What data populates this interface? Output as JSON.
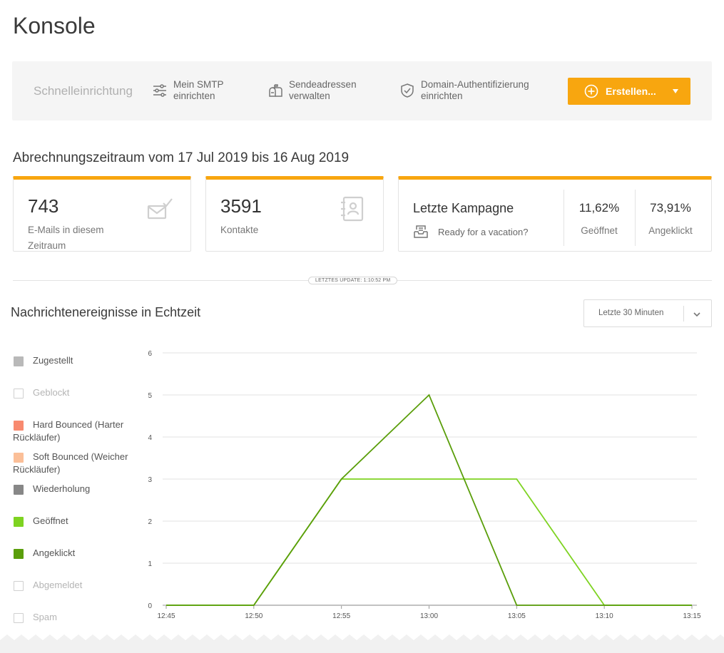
{
  "page": {
    "title": "Konsole"
  },
  "quick_setup": {
    "label": "Schnelleinrichtung",
    "items": [
      {
        "icon": "sliders-icon",
        "line1": "Mein SMTP",
        "line2": "einrichten"
      },
      {
        "icon": "mailbox-icon",
        "line1": "Sendeadressen",
        "line2": "verwalten"
      },
      {
        "icon": "shield-check-icon",
        "line1": "Domain-Authentifizierung",
        "line2": "einrichten"
      }
    ],
    "create_button": {
      "label": "Erstellen...",
      "color": "#f8a60f"
    }
  },
  "billing": {
    "title": "Abrechnungszeitraum vom 17 Jul 2019 bis 16 Aug 2019",
    "emails": {
      "value": "743",
      "label": "E-Mails in diesem Zeitraum",
      "icon": "envelope-check-icon"
    },
    "contacts": {
      "value": "3591",
      "label": "Kontakte",
      "icon": "address-book-icon"
    },
    "campaign": {
      "label": "Letzte Kampagne",
      "name": "Ready for a vacation?",
      "icon": "mail-tray-icon",
      "opened": {
        "value": "11,62%",
        "label": "Geöffnet"
      },
      "clicked": {
        "value": "73,91%",
        "label": "Angeklickt"
      }
    }
  },
  "last_update": "LETZTES UPDATE: 1:10:52 PM",
  "events": {
    "title": "Nachrichtenereignisse in Echtzeit",
    "range": "Letzte 30 Minuten",
    "legend": [
      {
        "label": "Zugestellt",
        "color": "#b9b9b9",
        "active": true
      },
      {
        "label": "Geblockt",
        "color": "#ffffff",
        "active": false
      },
      {
        "label": "Hard Bounced (Harter Rückläufer)",
        "color": "#f88a6f",
        "active": true
      },
      {
        "label": "Soft Bounced (Weicher Rückläufer)",
        "color": "#fbbf98",
        "active": true
      },
      {
        "label": "Wiederholung",
        "color": "#878787",
        "active": true
      },
      {
        "label": "Geöffnet",
        "color": "#7ed321",
        "active": true
      },
      {
        "label": "Angeklickt",
        "color": "#5a9e0a",
        "active": true
      },
      {
        "label": "Abgemeldet",
        "color": "#ffffff",
        "active": false
      },
      {
        "label": "Spam",
        "color": "#ffffff",
        "active": false
      }
    ]
  },
  "chart_data": {
    "type": "line",
    "x": [
      "12:45",
      "12:50",
      "12:55",
      "13:00",
      "13:05",
      "13:10",
      "13:15"
    ],
    "ylim": [
      0,
      6
    ],
    "yticks": [
      0,
      1,
      2,
      3,
      4,
      5,
      6
    ],
    "grid": true,
    "series": [
      {
        "name": "Zugestellt",
        "color": "#b9b9b9",
        "values": [
          0,
          0,
          0,
          0,
          0,
          0,
          0
        ]
      },
      {
        "name": "Geöffnet",
        "color": "#7ed321",
        "values": [
          0,
          0,
          3,
          3,
          3,
          0,
          0
        ]
      },
      {
        "name": "Angeklickt",
        "color": "#5a9e0a",
        "values": [
          0,
          0,
          3,
          5,
          0,
          0,
          0
        ]
      }
    ]
  }
}
